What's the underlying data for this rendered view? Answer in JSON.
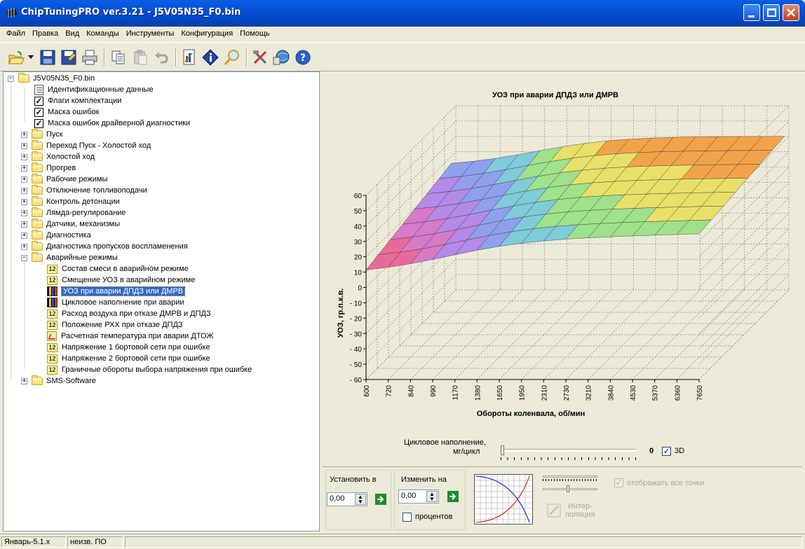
{
  "window": {
    "title": "ChipTuningPRO ver.3.21 - J5V05N35_F0.bin"
  },
  "menu": [
    "Файл",
    "Правка",
    "Вид",
    "Команды",
    "Инструменты",
    "Конфигурация",
    "Помощь"
  ],
  "toolbar_icons": [
    "open-icon",
    "dropdown-arrow-icon",
    "save-icon",
    "save-as-icon",
    "print-icon",
    "copy-icon",
    "paste-icon",
    "undo-icon",
    "report-icon",
    "info-icon",
    "search-icon",
    "tools-icon",
    "network-icon",
    "help-icon"
  ],
  "tree": {
    "root": "J5V05N35_F0.bin",
    "items": [
      {
        "label": "Идентификационные данные",
        "icon": "doc"
      },
      {
        "label": "Флаги комплектации",
        "icon": "check"
      },
      {
        "label": "Маска ошибок",
        "icon": "check"
      },
      {
        "label": "Маска ошибок драйверной диагностики",
        "icon": "check"
      },
      {
        "label": "Пуск",
        "icon": "folder"
      },
      {
        "label": "Переход Пуск - Холостой ход",
        "icon": "folder"
      },
      {
        "label": "Холостой ход",
        "icon": "folder"
      },
      {
        "label": "Прогрев",
        "icon": "folder"
      },
      {
        "label": "Рабочие режимы",
        "icon": "folder"
      },
      {
        "label": "Отключение топливоподачи",
        "icon": "folder"
      },
      {
        "label": "Контроль детонации",
        "icon": "folder"
      },
      {
        "label": "Лямда-регулирование",
        "icon": "folder"
      },
      {
        "label": "Датчики, механизмы",
        "icon": "folder"
      },
      {
        "label": "Диагностика",
        "icon": "folder"
      },
      {
        "label": "Диагностика пропусков воспламенения",
        "icon": "folder"
      },
      {
        "label": "Аварийные режимы",
        "icon": "folder-open"
      }
    ],
    "children": [
      {
        "label": "Состав смеси в аварийном режиме",
        "icon": "n12"
      },
      {
        "label": "Смещение УОЗ в аварийном режиме",
        "icon": "n12"
      },
      {
        "label": "УОЗ при аварии ДПДЗ или ДМРВ",
        "icon": "bar",
        "selected": true
      },
      {
        "label": "Цикловое наполнение при аварии",
        "icon": "bar"
      },
      {
        "label": "Расход воздуха при отказе ДМРВ и ДПДЗ",
        "icon": "n12"
      },
      {
        "label": "Положение РХХ при отказе ДПДЗ",
        "icon": "n12"
      },
      {
        "label": "Расчетная температура при аварии ДТОЖ",
        "icon": "graph"
      },
      {
        "label": "Напряжение 1 бортовой сети при ошибке",
        "icon": "n12"
      },
      {
        "label": "Напряжение 2 бортовой сети при ошибке",
        "icon": "n12"
      },
      {
        "label": "Граничные обороты выбора напряжения при ошибке",
        "icon": "n12"
      }
    ],
    "last": "SMS-Software"
  },
  "chart_data": {
    "type": "surface-3d",
    "title": "УОЗ при аварии ДПДЗ или ДМРВ",
    "xlabel": "Обороты коленвала, об/мин",
    "ylabel": "УОЗ, гр.п.к.в.",
    "x_ticks": [
      "600",
      "720",
      "840",
      "990",
      "1170",
      "1380",
      "1650",
      "1950",
      "2310",
      "2730",
      "3210",
      "3840",
      "4530",
      "5370",
      "6360",
      "7650"
    ],
    "y_ticks": [
      "60",
      "50",
      "40",
      "30",
      "20",
      "10",
      "0",
      "- 10",
      "- 20",
      "- 30",
      "- 40",
      "- 50",
      "- 60"
    ],
    "ylim": [
      -60,
      60
    ],
    "grid": true
  },
  "slider": {
    "label_line1": "Цикловое наполнение,",
    "label_line2": "мг/цикл",
    "value": "0",
    "checkbox_3d_label": "3D",
    "checkbox_3d_checked": true
  },
  "controls": {
    "set_to_label": "Установить в",
    "set_to_value": "0,00",
    "change_by_label": "Изменить на",
    "change_by_value": "0,00",
    "percent_label": "процентов",
    "interp_label_1": "Интер-",
    "interp_label_2": "поляция",
    "show_all_points_label": "отображать все точки"
  },
  "status": {
    "cell1": "Январь-5.1.x",
    "cell2": "неизв. ПО"
  }
}
